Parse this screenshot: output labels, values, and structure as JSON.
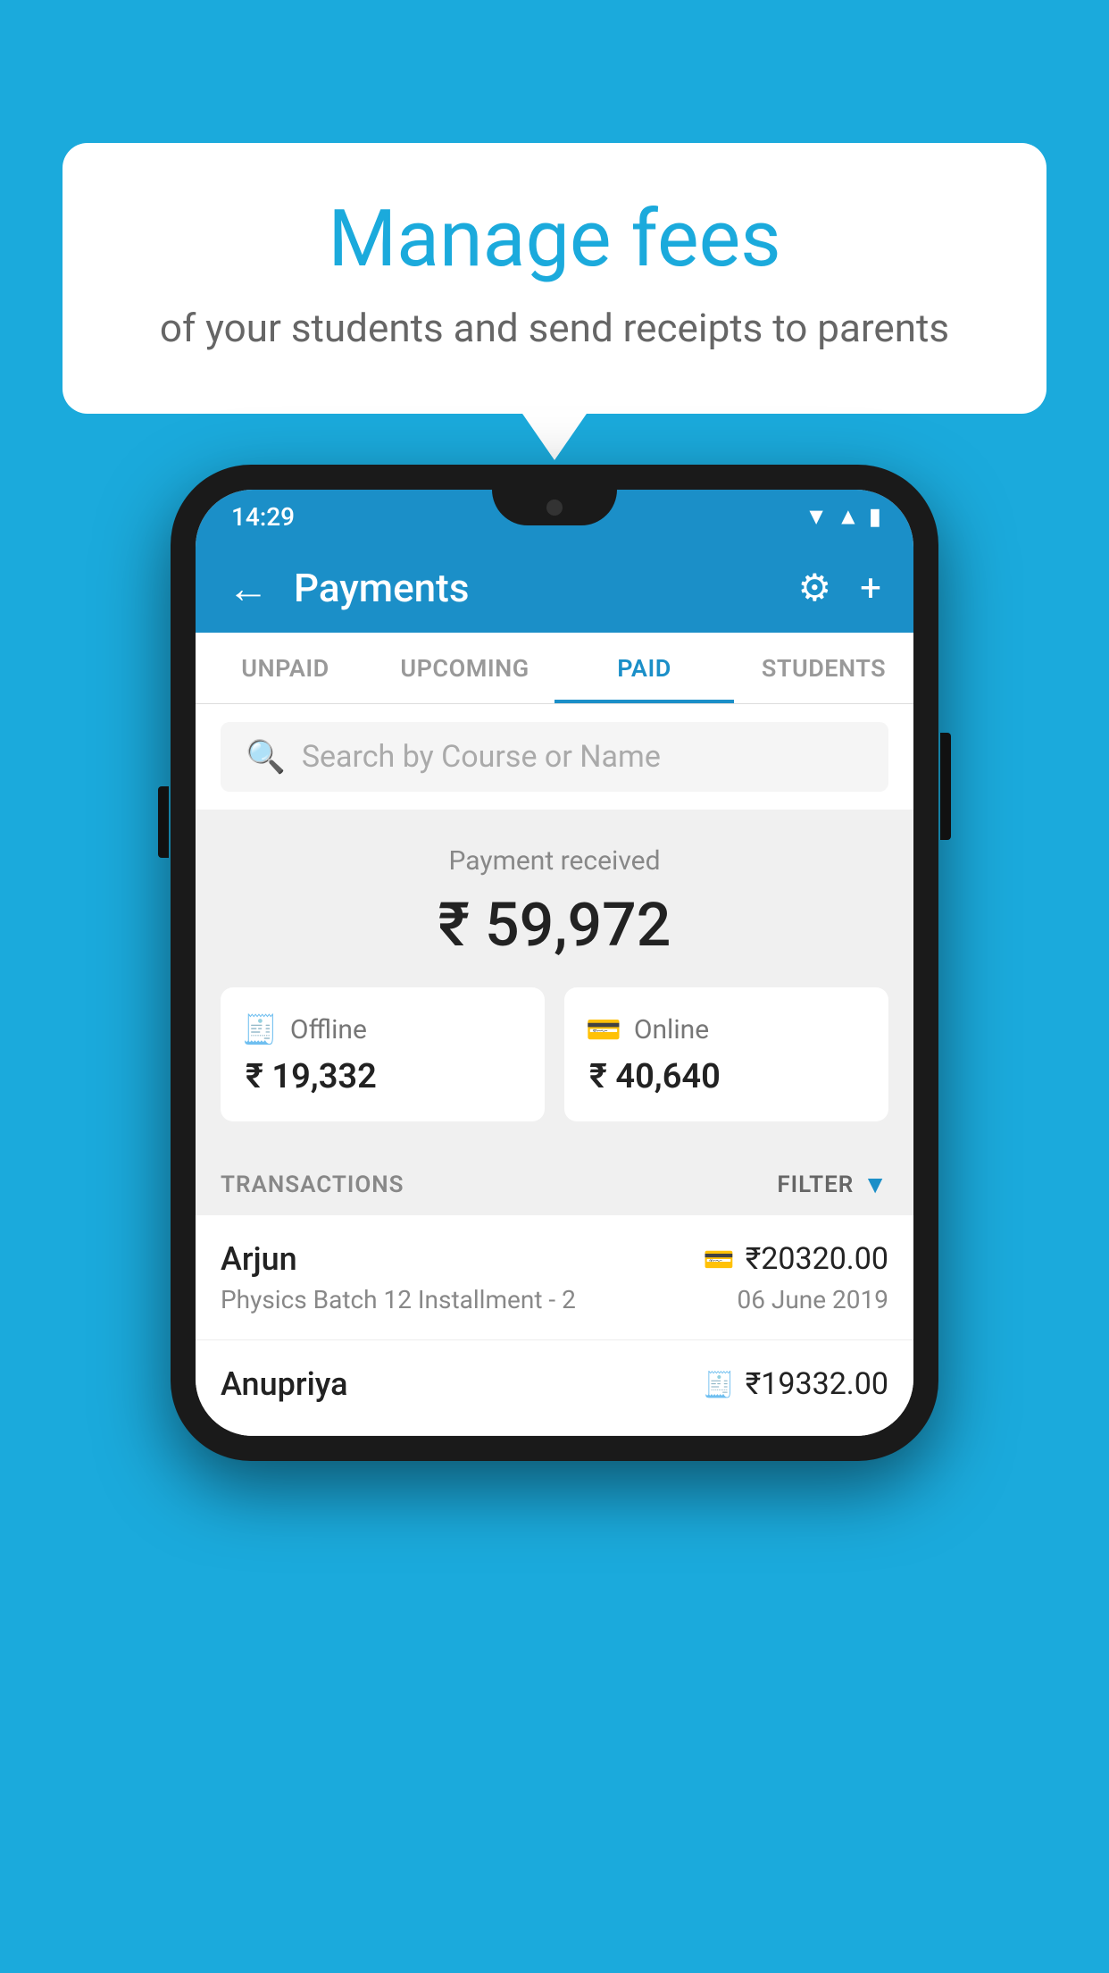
{
  "background_color": "#1BAADC",
  "speech_bubble": {
    "title": "Manage fees",
    "subtitle": "of your students and send receipts to parents"
  },
  "status_bar": {
    "time": "14:29",
    "wifi_icon": "▼",
    "signal_icon": "▲",
    "battery_icon": "▮"
  },
  "app_bar": {
    "title": "Payments",
    "back_label": "←",
    "settings_label": "⚙",
    "add_label": "+"
  },
  "tabs": [
    {
      "label": "UNPAID",
      "active": false
    },
    {
      "label": "UPCOMING",
      "active": false
    },
    {
      "label": "PAID",
      "active": true
    },
    {
      "label": "STUDENTS",
      "active": false
    }
  ],
  "search": {
    "placeholder": "Search by Course or Name"
  },
  "payment_summary": {
    "received_label": "Payment received",
    "total_amount": "₹ 59,972",
    "offline_label": "Offline",
    "offline_amount": "₹ 19,332",
    "online_label": "Online",
    "online_amount": "₹ 40,640"
  },
  "transactions_section": {
    "label": "TRANSACTIONS",
    "filter_label": "FILTER"
  },
  "transactions": [
    {
      "name": "Arjun",
      "course": "Physics Batch 12 Installment - 2",
      "amount": "₹20320.00",
      "date": "06 June 2019",
      "payment_type": "online"
    },
    {
      "name": "Anupriya",
      "course": "",
      "amount": "₹19332.00",
      "date": "",
      "payment_type": "offline"
    }
  ]
}
